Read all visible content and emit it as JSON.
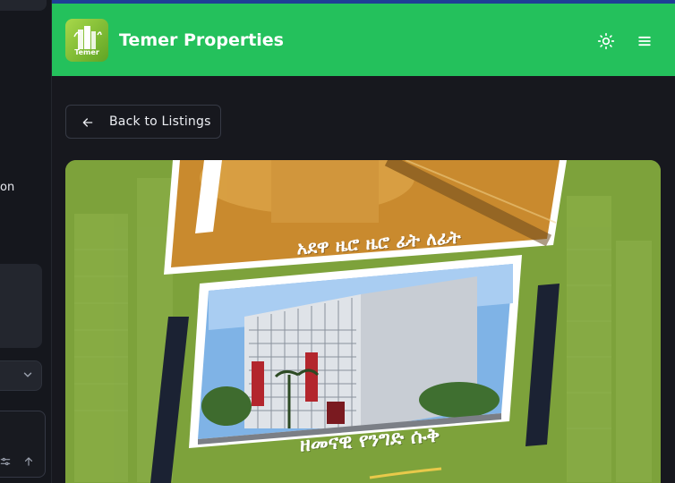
{
  "left_panel": {
    "partial_text": "on"
  },
  "header": {
    "logo_text": "Temer",
    "title": "Temer Properties",
    "colors": {
      "header_bg": "#24c15c",
      "topline": "#1e3e96"
    },
    "icons": [
      "sun-icon",
      "menu-icon"
    ]
  },
  "nav": {
    "back_label": "Back to Listings"
  },
  "banner": {
    "caption_top": "አደዋ ዜሮ ዜሮ ፊት ለፊት",
    "caption_bottom": "ዘመናዊ የንግድ ሱቅ",
    "background_color": "#7da23b"
  }
}
